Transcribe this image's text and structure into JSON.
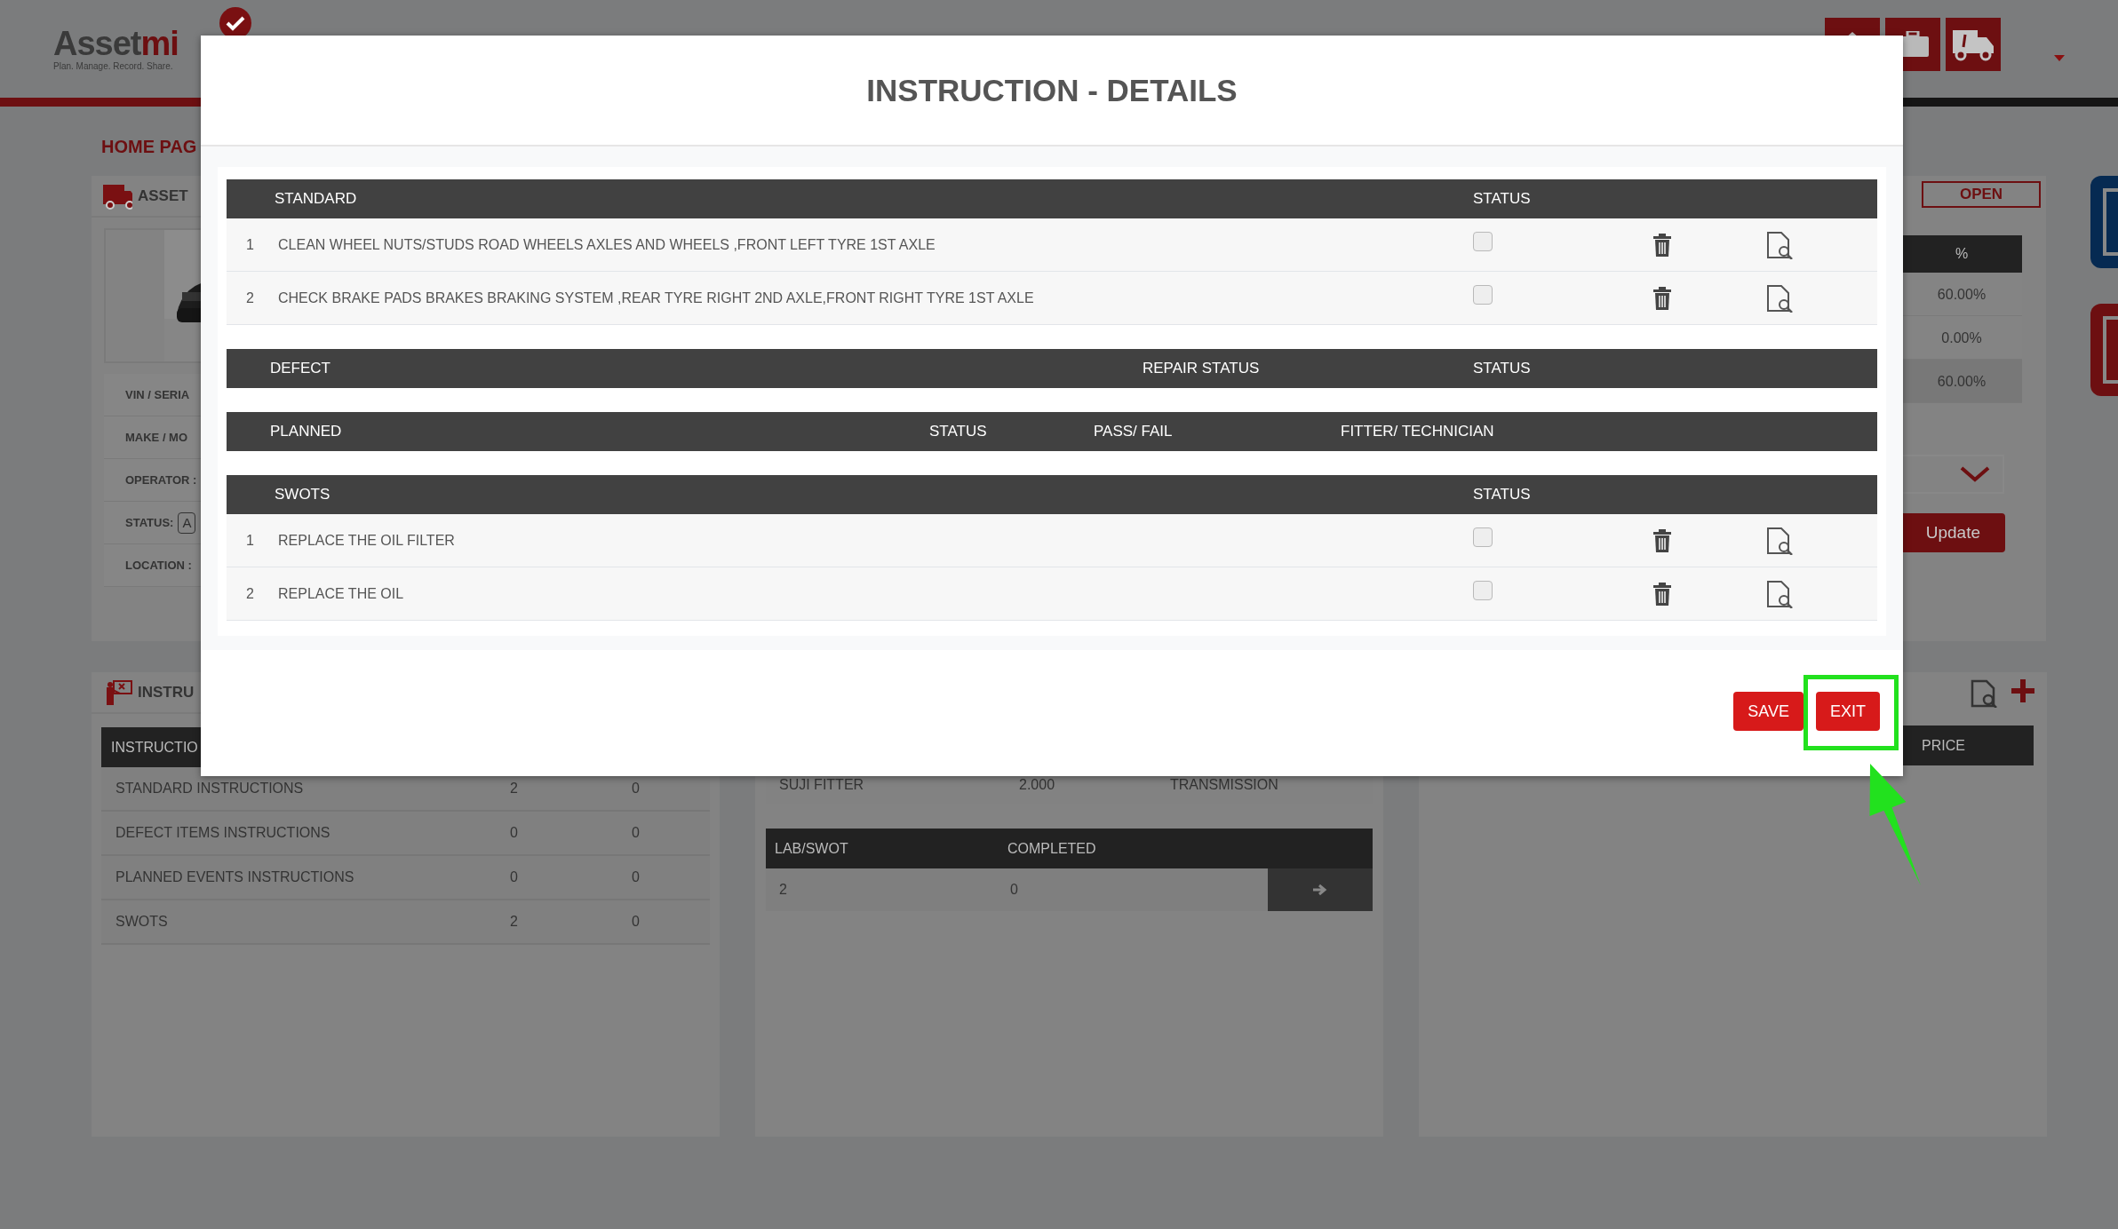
{
  "header": {
    "logo_dark": "Asset",
    "logo_red": "mi",
    "tagline": "Plan. Manage. Record. Share."
  },
  "breadcrumb": "HOME PAG",
  "asset_panel": {
    "title": "ASSET",
    "fields": [
      {
        "label": "VIN / SERIA"
      },
      {
        "label": "MAKE / MO"
      },
      {
        "label": "OPERATOR :"
      },
      {
        "label": "STATUS:",
        "value": "A"
      },
      {
        "label": "LOCATION :"
      }
    ]
  },
  "status_panel": {
    "badge": "OPEN",
    "percent_header": "%",
    "percent_rows": [
      {
        "value": "60.00%",
        "kind": "row"
      },
      {
        "value": "0.00%",
        "kind": "row"
      },
      {
        "value": "60.00%",
        "kind": "total"
      }
    ],
    "update_button": "Update"
  },
  "instructions_panel": {
    "title": "INSTRU",
    "header": "INSTRUCTIO",
    "rows": [
      {
        "name": "STANDARD INSTRUCTIONS",
        "column_2": "2",
        "column_3": "0"
      },
      {
        "name": "DEFECT ITEMS INSTRUCTIONS",
        "column_2": "0",
        "column_3": "0"
      },
      {
        "name": "PLANNED EVENTS INSTRUCTIONS",
        "column_2": "0",
        "column_3": "0"
      },
      {
        "name": "SWOTS",
        "column_2": "2",
        "column_3": "0"
      }
    ]
  },
  "jobs_panel": {
    "row": [
      "SUJI FITTER",
      "2.000",
      "TRANSMISSION"
    ],
    "columns": [
      "LAB/SWOT",
      "COMPLETED"
    ],
    "rows": [
      [
        "2",
        "0"
      ]
    ]
  },
  "parts_panel": {
    "columns": [
      "PRICE"
    ]
  },
  "modal": {
    "title": "INSTRUCTION - DETAILS",
    "sections": [
      {
        "kind": "list",
        "columns": [
          "STANDARD",
          "STATUS"
        ],
        "rows": [
          {
            "number": "1",
            "text": "CLEAN WHEEL NUTS/STUDS ROAD WHEELS AXLES AND WHEELS ,FRONT LEFT TYRE 1ST AXLE",
            "checked": false
          },
          {
            "number": "2",
            "text": "CHECK BRAKE PADS BRAKES BRAKING SYSTEM ,REAR TYRE RIGHT 2ND AXLE,FRONT RIGHT TYRE 1ST AXLE",
            "checked": false
          }
        ]
      },
      {
        "kind": "defect",
        "columns": [
          "DEFECT",
          "REPAIR STATUS",
          "STATUS"
        ]
      },
      {
        "kind": "planned",
        "columns": [
          "PLANNED",
          "STATUS",
          "PASS/ FAIL",
          "FITTER/ TECHNICIAN"
        ]
      },
      {
        "kind": "list",
        "columns": [
          "SWOTS",
          "STATUS"
        ],
        "rows": [
          {
            "number": "1",
            "text": "REPLACE THE OIL FILTER",
            "checked": false
          },
          {
            "number": "2",
            "text": "REPLACE THE OIL",
            "checked": false
          }
        ]
      }
    ],
    "buttons": [
      {
        "label": "SAVE",
        "highlighted": false
      },
      {
        "label": "EXIT",
        "highlighted": true
      }
    ]
  }
}
